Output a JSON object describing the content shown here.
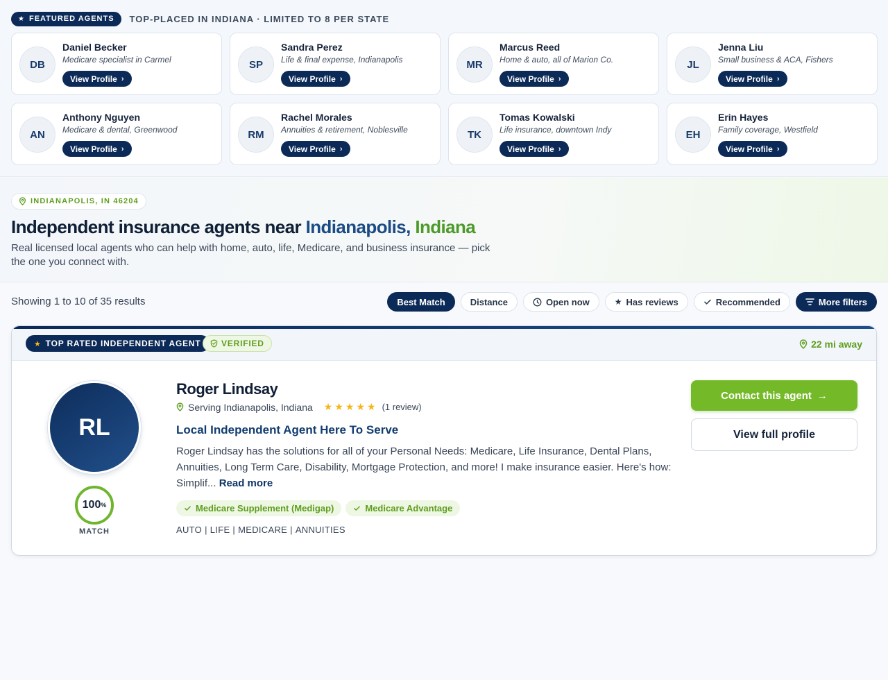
{
  "featured": {
    "badge": "FEATURED AGENTS",
    "subtitle": "TOP-PLACED IN INDIANA · LIMITED TO 8 PER STATE",
    "view_label": "View Profile",
    "agents": [
      {
        "initials": "DB",
        "name": "Daniel Becker",
        "desc": "Medicare specialist in Carmel"
      },
      {
        "initials": "SP",
        "name": "Sandra Perez",
        "desc": "Life & final expense, Indianapolis"
      },
      {
        "initials": "MR",
        "name": "Marcus Reed",
        "desc": "Home & auto, all of Marion Co."
      },
      {
        "initials": "JL",
        "name": "Jenna Liu",
        "desc": "Small business & ACA, Fishers"
      },
      {
        "initials": "AN",
        "name": "Anthony Nguyen",
        "desc": "Medicare & dental, Greenwood"
      },
      {
        "initials": "RM",
        "name": "Rachel Morales",
        "desc": "Annuities & retirement, Noblesville"
      },
      {
        "initials": "TK",
        "name": "Tomas Kowalski",
        "desc": "Life insurance, downtown Indy"
      },
      {
        "initials": "EH",
        "name": "Erin Hayes",
        "desc": "Family coverage, Westfield"
      }
    ]
  },
  "hero": {
    "location": "INDIANAPOLIS, IN 46204",
    "title_prefix": "Independent insurance agents near ",
    "title_city": "Indianapolis,",
    "title_state": "Indiana",
    "description": "Real licensed local agents who can help with home, auto, life, Medicare, and business insurance — pick the one you connect with."
  },
  "results": {
    "count_text": "Showing 1 to 10 of 35 results",
    "filters": {
      "best_match": "Best Match",
      "distance": "Distance",
      "open_now": "Open now",
      "has_reviews": "Has reviews",
      "recommended": "Recommended",
      "more_filters": "More filters"
    }
  },
  "listing": {
    "top_badge": "TOP RATED INDEPENDENT AGENT",
    "verified": "VERIFIED",
    "distance": "22 mi away",
    "initials": "RL",
    "match_value": "100",
    "match_unit": "%",
    "match_label": "MATCH",
    "name": "Roger Lindsay",
    "serving": "Serving Indianapolis, Indiana",
    "rating": 5,
    "review_count": "(1 review)",
    "tagline": "Local Independent Agent Here To Serve",
    "bio": "Roger Lindsay has the solutions for all of your Personal Needs: Medicare, Life Insurance, Dental Plans, Annuities, Long Term Care, Disability, Mortgage Protection, and more! I make insurance easier. Here's how: Simplif...",
    "read_more": "Read more",
    "specialties": [
      "Medicare Supplement (Medigap)",
      "Medicare Advantage"
    ],
    "lines": [
      "AUTO",
      "LIFE",
      "MEDICARE",
      "ANNUITIES"
    ],
    "contact_label": "Contact this agent",
    "profile_label": "View full profile"
  },
  "colors": {
    "navy": "#0c2a57",
    "green": "#74b928",
    "star": "#f5b51a"
  }
}
